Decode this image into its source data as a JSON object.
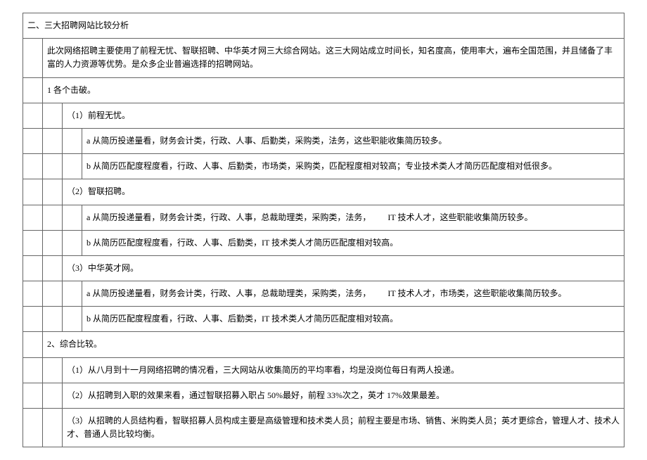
{
  "title": "二、三大招聘网站比较分析",
  "intro": "此次网络招聘主要使用了前程无忧、智联招聘、中华英才网三大综合网站。这三大网站成立时间长，知名度高，使用率大，遍布全国范围，并且储备了丰 富的人力资源等优势。是众多企业普遍选择的招聘网站。",
  "section1": {
    "title": "1 各个击破。",
    "item1": {
      "title": "（1）前程无忧。",
      "a": "a 从简历投递量看，财务会计类，行政、人事、后勤类，采购类，法务，这些职能收集简历较多。",
      "b": "b 从简历匹配度程度看，行政、人事、后勤类，市场类，采购类，匹配程度相对较高；专业技术类人才简历匹配度相对低很多。"
    },
    "item2": {
      "title": "（2）智联招聘。",
      "a": "a 从简历投递量看，财务会计类，行政、人事，总裁助理类，采购类，法务，  IT 技术人才，这些职能收集简历较多。",
      "b": "b 从简历匹配度程度看，行政、人事、后勤类，IT 技术类人才简历匹配度相对较高。"
    },
    "item3": {
      "title": "（3）中华英才网。",
      "a": "a 从简历投递量看，财务会计类，行政、人事，总裁助理类，采购类，法务，  IT 技术人才，市场类，这些职能收集简历较多。",
      "b": "b 从简历匹配度程度看，行政、人事、后勤类，IT 技术类人才简历匹配度相对较高。"
    }
  },
  "section2": {
    "title": "2、综合比较。",
    "p1": "（1）从八月到十一月网络招聘的情况看，三大网站从收集简历的平均率看，均是没岗位每日有两人投递。",
    "p2": "（2）从招聘到入职的效果来看，通过智联招募入职占 50%最好，前程 33%次之，英才 17%效果最差。",
    "p3": "（3）从招聘的人员结构看，智联招募人员构成主要是高级管理和技术类人员；前程主要是市场、销售、米购类人员；英才更综合，管理人才、技术人 才、普通人员比较均衡。"
  }
}
